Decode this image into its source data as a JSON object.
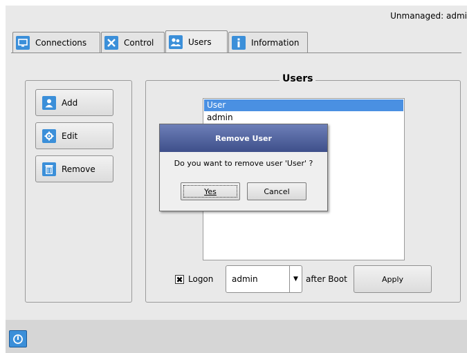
{
  "status": {
    "text": "Unmanaged: admi"
  },
  "tabs": [
    {
      "label": "Connections",
      "icon": "monitor-icon"
    },
    {
      "label": "Control",
      "icon": "tools-icon"
    },
    {
      "label": "Users",
      "icon": "users-icon",
      "active": true
    },
    {
      "label": "Information",
      "icon": "info-icon"
    }
  ],
  "actions": {
    "add_label": "Add",
    "edit_label": "Edit",
    "remove_label": "Remove"
  },
  "users_group": {
    "title": "Users",
    "list": [
      "User",
      "admin"
    ],
    "selected": "User"
  },
  "dialog": {
    "title": "Remove User",
    "message": "Do you want to remove user  'User' ?",
    "yes_label": "Yes",
    "cancel_label": "Cancel"
  },
  "logon": {
    "checked": true,
    "label": "Logon",
    "user_value": "admin",
    "after_label": "after Boot",
    "apply_label": "Apply"
  },
  "colors": {
    "accent": "#3b8fd9",
    "selection": "#4a90e2",
    "dialog_title": "#3e4f8a"
  }
}
